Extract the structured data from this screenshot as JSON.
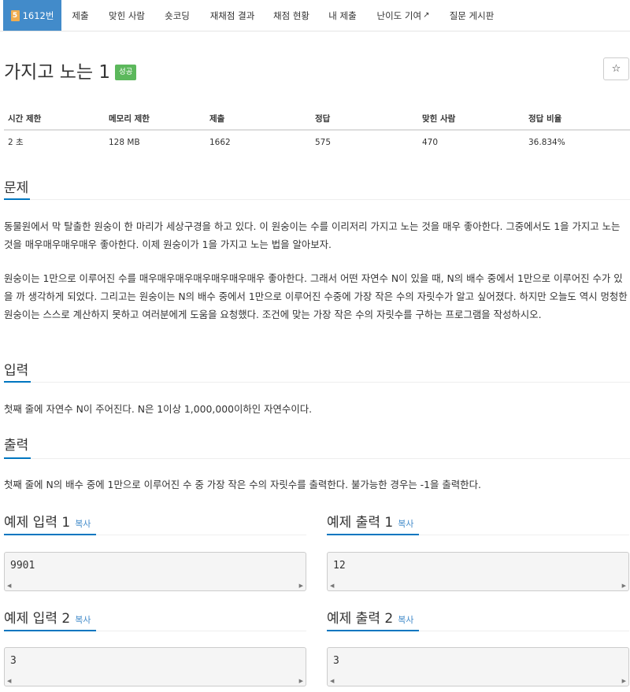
{
  "nav": {
    "tabs": [
      {
        "label": "1612번",
        "icon": "tier-5-icon",
        "icon_text": "5",
        "active": true
      },
      {
        "label": "제출"
      },
      {
        "label": "맞힌 사람"
      },
      {
        "label": "숏코딩"
      },
      {
        "label": "재채점 결과"
      },
      {
        "label": "채점 현황"
      },
      {
        "label": "내 제출"
      },
      {
        "label": "난이도 기여",
        "icon": "external-link-icon"
      },
      {
        "label": "질문 게시판"
      }
    ]
  },
  "problem": {
    "title": "가지고 노는 1",
    "status": "성공",
    "star_icon": "☆"
  },
  "stats": {
    "headers": [
      "시간 제한",
      "메모리 제한",
      "제출",
      "정답",
      "맞힌 사람",
      "정답 비율"
    ],
    "values": [
      "2 초",
      "128 MB",
      "1662",
      "575",
      "470",
      "36.834%"
    ]
  },
  "sections": {
    "problem_heading": "문제",
    "problem_p1": "동물원에서 막 탈출한 원숭이 한 마리가 세상구경을 하고 있다. 이 원숭이는 수를 이리저리 가지고 노는 것을 매우 좋아한다. 그중에서도 1을 가지고 노는 것을 매우매우매우매우 좋아한다. 이제 원숭이가 1을 가지고 노는 법을 알아보자.",
    "problem_p2": "원숭이는 1만으로 이루어진 수를 매우매우매우매우매우매우매우 좋아한다. 그래서 어떤 자연수 N이 있을 때, N의 배수 중에서 1만으로 이루어진 수가 있을 까 생각하게 되었다. 그리고는 원숭이는 N의 배수 중에서 1만으로 이루어진 수중에 가장 작은 수의 자릿수가 알고 싶어졌다. 하지만 오늘도 역시 멍청한 원숭이는 스스로 계산하지 못하고 여러분에게 도움을 요청했다. 조건에 맞는 가장 작은 수의 자릿수를 구하는 프로그램을 작성하시오.",
    "input_heading": "입력",
    "input_text": "첫째 줄에 자연수 N이 주어진다. N은 1이상 1,000,000이하인 자연수이다.",
    "output_heading": "출력",
    "output_text": "첫째 줄에 N의 배수 중에 1만으로 이루어진 수 중 가장 작은 수의 자릿수를 출력한다. 불가능한 경우는 -1을 출력한다."
  },
  "samples": {
    "copy_label": "복사",
    "input1_heading": "예제 입력 1",
    "input1_value": "9901",
    "output1_heading": "예제 출력 1",
    "output1_value": "12",
    "input2_heading": "예제 입력 2",
    "input2_value": "3",
    "output2_heading": "예제 출력 2",
    "output2_value": "3"
  },
  "colors": {
    "active_tab": "#428bca",
    "status_success": "#5cb85c",
    "heading_underline": "#0076c0",
    "tier_badge": "#f0ad4e"
  }
}
